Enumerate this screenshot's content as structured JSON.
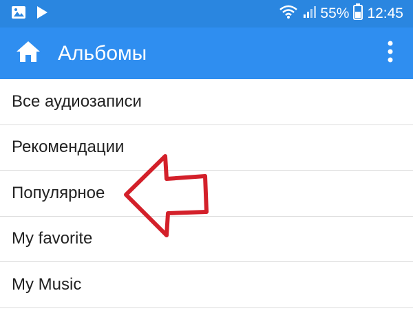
{
  "status_bar": {
    "battery_percent": "55%",
    "time": "12:45",
    "icons": [
      "image-icon",
      "play-icon",
      "wifi-icon",
      "signal-icon",
      "battery-icon"
    ]
  },
  "app_bar": {
    "title": "Альбомы",
    "icons": [
      "home-icon",
      "more-vert-icon"
    ],
    "color": "#2f8ef0"
  },
  "list": {
    "items": [
      {
        "label": "Все аудиозаписи"
      },
      {
        "label": "Рекомендации"
      },
      {
        "label": "Популярное"
      },
      {
        "label": "My favorite"
      },
      {
        "label": "My Music"
      }
    ]
  },
  "annotation": {
    "type": "arrow",
    "color": "#d3202a",
    "points_to": "Популярное"
  }
}
